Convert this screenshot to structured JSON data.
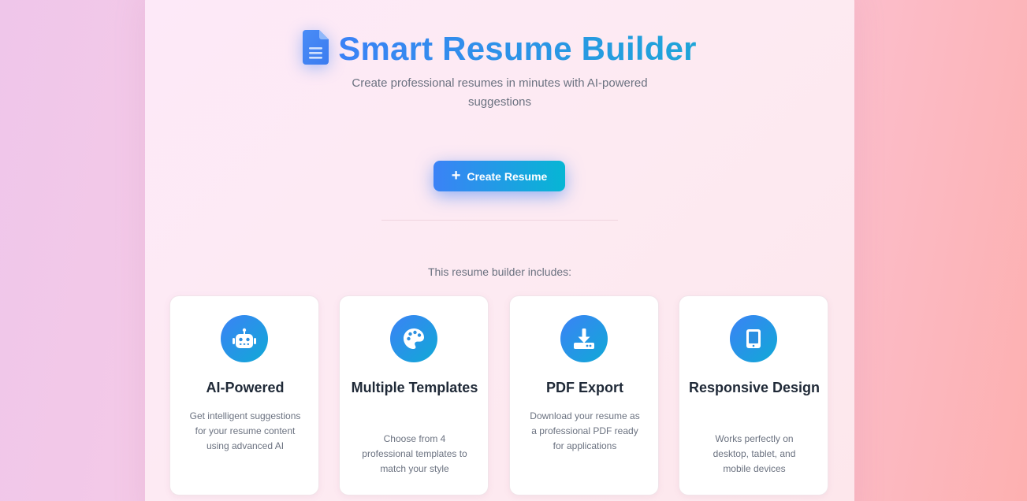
{
  "header": {
    "icon": "document-icon",
    "title": "Smart Resume Builder",
    "subtitle": "Create professional resumes in minutes with AI-powered suggestions"
  },
  "cta": {
    "icon": "plus-icon",
    "label": "Create Resume"
  },
  "features": {
    "heading": "This resume builder includes:",
    "items": [
      {
        "icon": "robot-icon",
        "title": "AI-Powered",
        "description": "Get intelligent suggestions for your resume content using advanced AI"
      },
      {
        "icon": "palette-icon",
        "title": "Multiple Templates",
        "description": "Choose from 4 professional templates to match your style"
      },
      {
        "icon": "download-icon",
        "title": "PDF Export",
        "description": "Download your resume as a professional PDF ready for applications"
      },
      {
        "icon": "tablet-icon",
        "title": "Responsive Design",
        "description": "Works perfectly on desktop, tablet, and mobile devices"
      }
    ]
  },
  "colors": {
    "accent_start": "#3b82f6",
    "accent_end": "#06b6d4",
    "text_dark": "#1f2937",
    "text_muted": "#6b7280"
  }
}
